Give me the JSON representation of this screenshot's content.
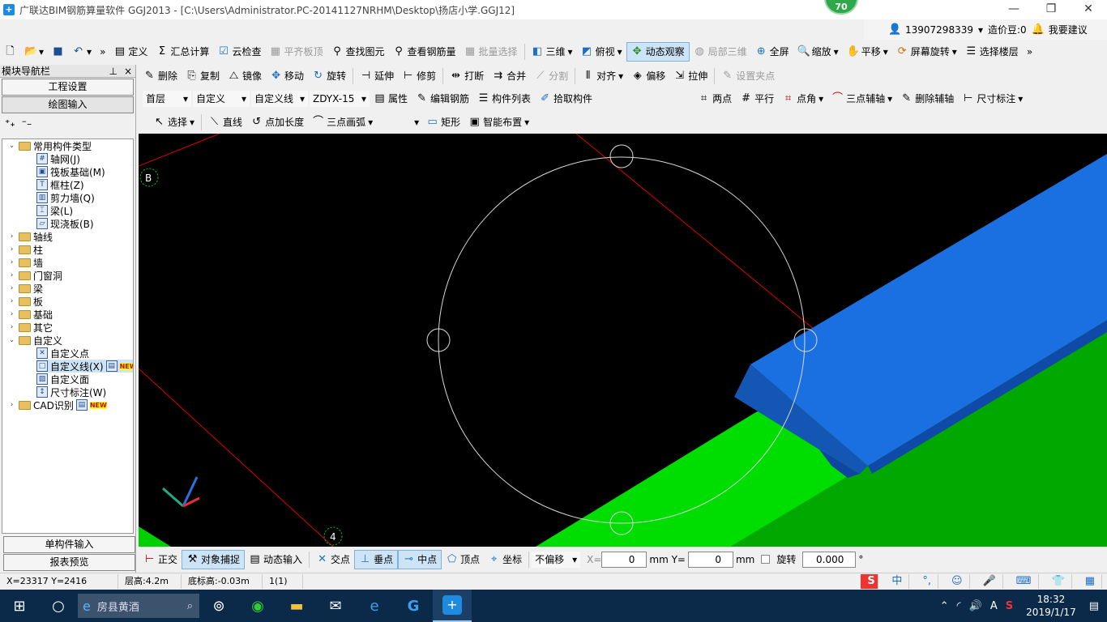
{
  "window": {
    "title": "广联达BIM钢筋算量软件 GGJ2013 - [C:\\Users\\Administrator.PC-20141127NRHM\\Desktop\\扬店小学.GGJ12]",
    "badge": "70"
  },
  "userbar": {
    "account": "13907298339",
    "beans": "造价豆:0",
    "suggest": "我要建议"
  },
  "toolbar1": [
    "定义",
    "汇总计算",
    "云检查",
    "平齐板顶",
    "查找图元",
    "查看钢筋量",
    "批量选择",
    "三维",
    "俯视",
    "动态观察",
    "局部三维",
    "全屏",
    "缩放",
    "平移",
    "屏幕旋转",
    "选择楼层"
  ],
  "toolbar2": [
    "删除",
    "复制",
    "镜像",
    "移动",
    "旋转",
    "延伸",
    "修剪",
    "打断",
    "合并",
    "分割",
    "对齐",
    "偏移",
    "拉伸",
    "设置夹点"
  ],
  "toolbar3": {
    "floor": "首层",
    "type": "自定义",
    "subtype": "自定义线",
    "name": "ZDYX-15",
    "items": [
      "属性",
      "编辑钢筋",
      "构件列表",
      "拾取构件"
    ],
    "axis_items": [
      "两点",
      "平行",
      "点角",
      "三点辅轴",
      "删除辅轴",
      "尺寸标注"
    ]
  },
  "toolbar4": [
    "选择",
    "直线",
    "点加长度",
    "三点画弧",
    "矩形",
    "智能布置"
  ],
  "panel": {
    "title": "模块导航栏",
    "pin": "ᵖ",
    "close": "×",
    "btn_project": "工程设置",
    "btn_draw": "绘图输入",
    "btn_single": "单构件输入",
    "btn_report": "报表预览"
  },
  "tree": {
    "common": "常用构件类型",
    "common_items": [
      "轴网(J)",
      "筏板基础(M)",
      "框柱(Z)",
      "剪力墙(Q)",
      "梁(L)",
      "现浇板(B)"
    ],
    "folders": [
      "轴线",
      "柱",
      "墙",
      "门窗洞",
      "梁",
      "板",
      "基础",
      "其它"
    ],
    "custom": "自定义",
    "custom_items": [
      "自定义点",
      "自定义线(X)",
      "自定义面",
      "尺寸标注(W)"
    ],
    "cad": "CAD识别",
    "new": "NEW"
  },
  "canvas": {
    "axis_b": "B",
    "axis_4": "4"
  },
  "snapbar": {
    "items": [
      "正交",
      "对象捕捉",
      "动态输入",
      "交点",
      "垂点",
      "中点",
      "顶点",
      "坐标"
    ],
    "offset": "不偏移",
    "x_label": "X=",
    "x": "0",
    "y_label": "mm Y=",
    "y": "0",
    "mm": "mm",
    "rotate": "旋转",
    "rotate_val": "0.000",
    "deg": "°"
  },
  "status": {
    "coords": "X=23317 Y=2416",
    "floor_h": "层高:4.2m",
    "base_h": "底标高:-0.03m",
    "count": "1(1)"
  },
  "taskbar": {
    "search": "房县黄酒",
    "time": "18:32",
    "date": "2019/1/17",
    "ime": "中"
  }
}
